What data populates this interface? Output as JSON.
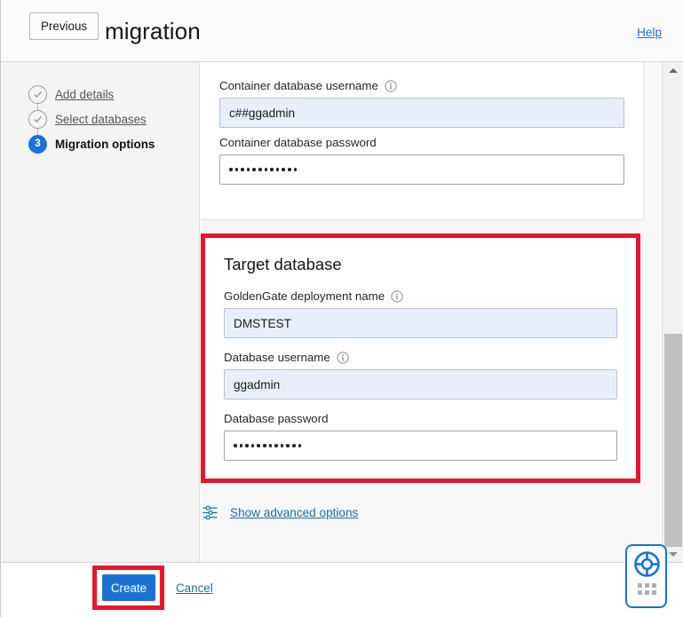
{
  "header": {
    "title": "Create migration",
    "help_label": "Help"
  },
  "sidebar": {
    "steps": [
      {
        "label": "Add details",
        "marker": "check-circle-icon",
        "state": "done"
      },
      {
        "label": "Select databases",
        "marker": "check-circle-icon",
        "state": "done"
      },
      {
        "label": "Migration options",
        "marker": "3",
        "state": "current"
      }
    ]
  },
  "source_card": {
    "fields": [
      {
        "label": "Container database username",
        "info": "info-icon",
        "value": "c##ggadmin",
        "type": "text",
        "filled": true
      },
      {
        "label": "Container database password",
        "info": null,
        "value": "",
        "masked_length": 12,
        "type": "password",
        "filled": false
      }
    ]
  },
  "target_card": {
    "title": "Target database",
    "annotation_color": "#e8152b",
    "fields": [
      {
        "label": "GoldenGate deployment name",
        "info": "info-icon",
        "value": "DMSTEST",
        "type": "text",
        "filled": true
      },
      {
        "label": "Database username",
        "info": "info-icon",
        "value": "ggadmin",
        "type": "text",
        "filled": true
      },
      {
        "label": "Database password",
        "info": null,
        "value": "",
        "masked_length": 12,
        "type": "password",
        "filled": false
      }
    ]
  },
  "advanced": {
    "icon": "sliders-icon",
    "label": "Show advanced options"
  },
  "footer": {
    "previous_label": "Previous",
    "create_label": "Create",
    "cancel_label": "Cancel",
    "create_accent": "#1a73d4",
    "create_annotation_color": "#e8152b"
  },
  "support_widget": {
    "icon": "lifebuoy-icon",
    "handle": "drag-handle-dots",
    "accent": "#1a73d4"
  },
  "scrollbar": {
    "up_arrow": "chevron-up-icon",
    "down_arrow": "chevron-down-icon",
    "thumb": "scrollbar-thumb"
  }
}
